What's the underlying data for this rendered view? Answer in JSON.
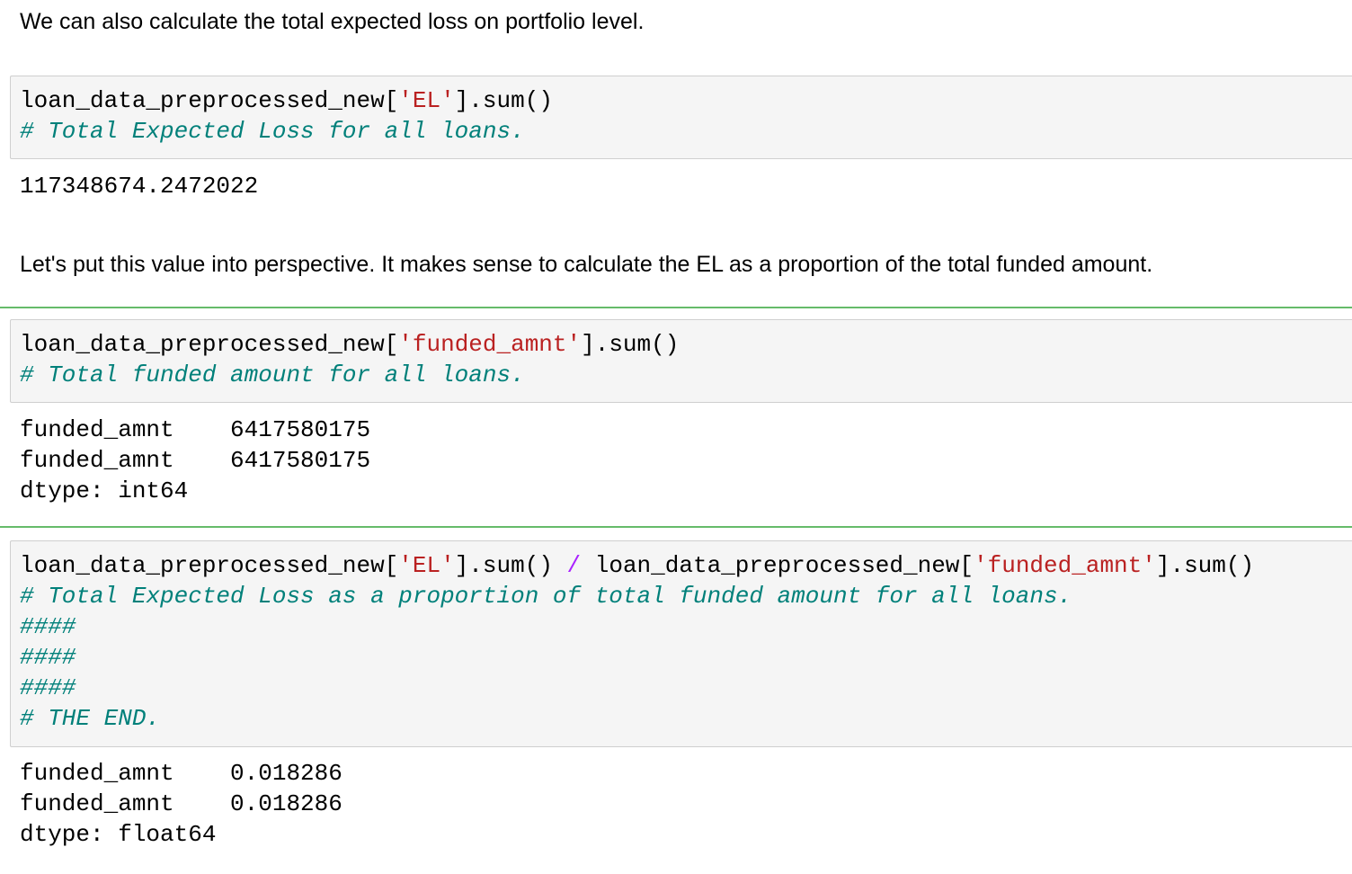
{
  "markdown": {
    "intro": "We can also calculate the total expected loss on portfolio level.",
    "perspective": "Let's put this value into perspective. It makes sense to calculate the EL as a proportion of the total funded amount."
  },
  "cell1": {
    "code": {
      "var": "loan_data_preprocessed_new[",
      "key": "'EL'",
      "tail": "].sum()"
    },
    "comment": "# Total Expected Loss for all loans.",
    "output": "117348674.2472022"
  },
  "cell2": {
    "code": {
      "var": "loan_data_preprocessed_new[",
      "key": "'funded_amnt'",
      "tail": "].sum()"
    },
    "comment": "# Total funded amount for all loans.",
    "output": [
      "funded_amnt    6417580175",
      "funded_amnt    6417580175",
      "dtype: int64"
    ]
  },
  "cell3": {
    "code": {
      "var1": "loan_data_preprocessed_new[",
      "key1": "'EL'",
      "tail1": "].sum() ",
      "op": "/",
      "var2": " loan_data_preprocessed_new[",
      "key2": "'funded_amnt'",
      "tail2": "].sum()"
    },
    "comments": [
      "# Total Expected Loss as a proportion of total funded amount for all loans.",
      "####",
      "####",
      "####",
      "# THE END."
    ],
    "output": [
      "funded_amnt    0.018286",
      "funded_amnt    0.018286",
      "dtype: float64"
    ]
  }
}
